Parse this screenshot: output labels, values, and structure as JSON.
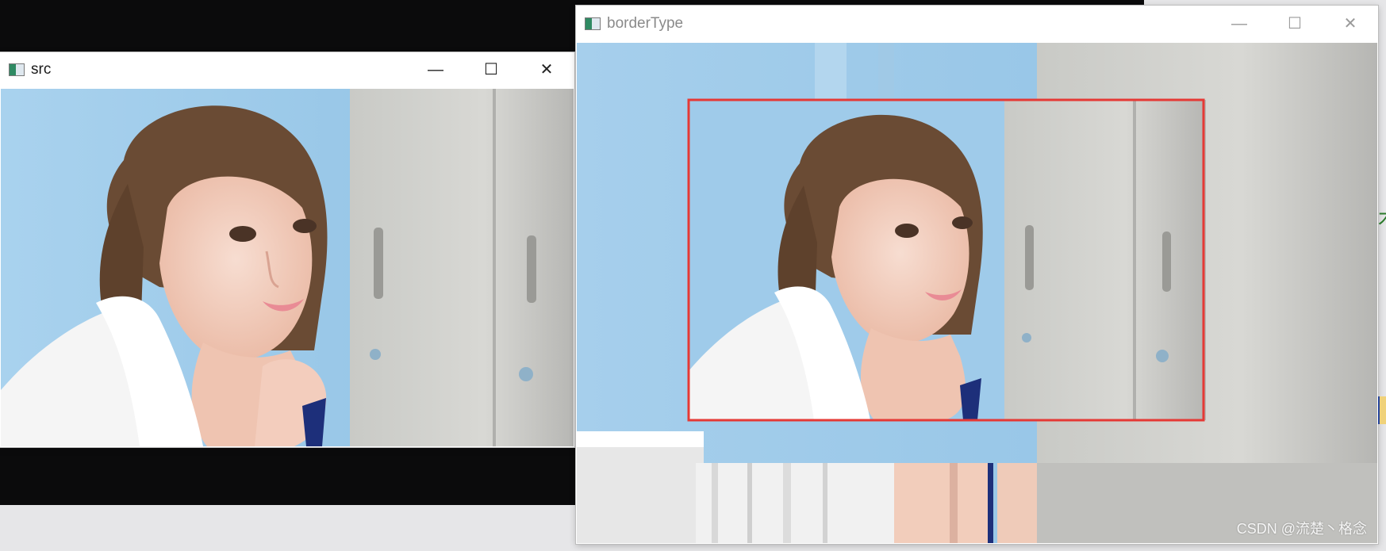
{
  "windows": {
    "src": {
      "title": "src",
      "controls": {
        "minimize": "—",
        "maximize": "☐",
        "close": "✕"
      }
    },
    "border": {
      "title": "borderType",
      "controls": {
        "minimize": "—",
        "maximize": "☐",
        "close": "✕"
      }
    }
  },
  "watermark": "CSDN @流楚丶格念",
  "right_edge_text": "木",
  "colors": {
    "highlight_rect": "#e53935",
    "sky_blue": "#9bc7e7",
    "wall_gray": "#c7c8c4",
    "skin": "#f1cfc0",
    "hair": "#6a4b34",
    "white_cloth": "#f5f5f5"
  }
}
